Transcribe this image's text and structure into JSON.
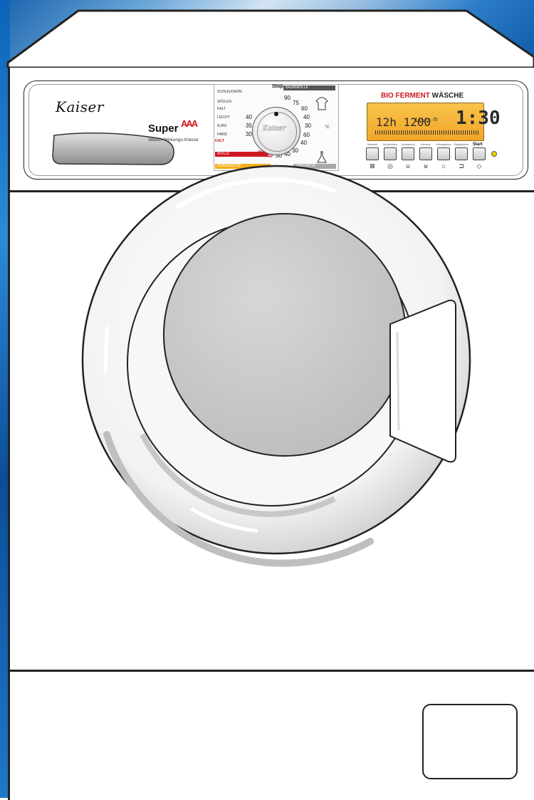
{
  "brand": "Kaiser",
  "panel": {
    "super_label": "Super",
    "aaa_label": "AAA",
    "efficiency_text": "Wasch-Wirkungs-Klasse"
  },
  "dial": {
    "stop_label": "Stop",
    "programs": [
      "SCHLEUDERN",
      "SPÜLEN",
      "KALT",
      "LEICHT",
      "KURZ",
      "HAND"
    ],
    "section_baumwolle": "BAUMWOLLE",
    "section_wolle": "WOLLE",
    "section_kalt": "KALT",
    "section_feinwasche": "FEINWÄSCHE",
    "section_synthetik": "SYNTHETIK",
    "unit": "°C",
    "temps_left": [
      "40",
      "35",
      "30"
    ],
    "temps_right": [
      "90",
      "75",
      "60",
      "40",
      "30",
      "60",
      "40",
      "30"
    ],
    "temps_bottom": [
      "30",
      "40",
      "30",
      "40"
    ]
  },
  "display": {
    "title_red": "BIO FERMENT",
    "title_dark": "WÄSCHE",
    "lcd_left": "12h 1200",
    "lcd_time": "1:30",
    "start_label": "Start",
    "buttons": [
      "Startzeit",
      "Schleudern",
      "Vorwäsche",
      "Intensiv",
      "Extraspülen",
      "Bügelleicht"
    ],
    "button_icons": [
      "timer-icon",
      "spin-icon",
      "prewash-icon",
      "intensive-icon",
      "rinse-icon",
      "iron-icon",
      "start-icon"
    ]
  },
  "colors": {
    "accent_red": "#d0161f",
    "lcd_orange": "#f2a629",
    "background_blue": "#0d63b8"
  }
}
